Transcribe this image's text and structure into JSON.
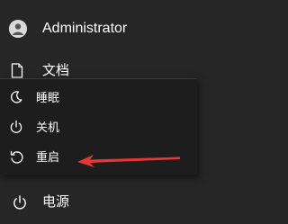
{
  "user": {
    "name": "Administrator",
    "icon": "user-avatar-icon"
  },
  "documents": {
    "label": "文档",
    "icon": "document-icon"
  },
  "power_menu": {
    "items": [
      {
        "label": "睡眠",
        "icon": "moon-icon"
      },
      {
        "label": "关机",
        "icon": "power-icon"
      },
      {
        "label": "重启",
        "icon": "restart-icon"
      }
    ]
  },
  "power": {
    "label": "电源",
    "icon": "power-icon"
  },
  "annotation": {
    "color": "#e53935"
  }
}
